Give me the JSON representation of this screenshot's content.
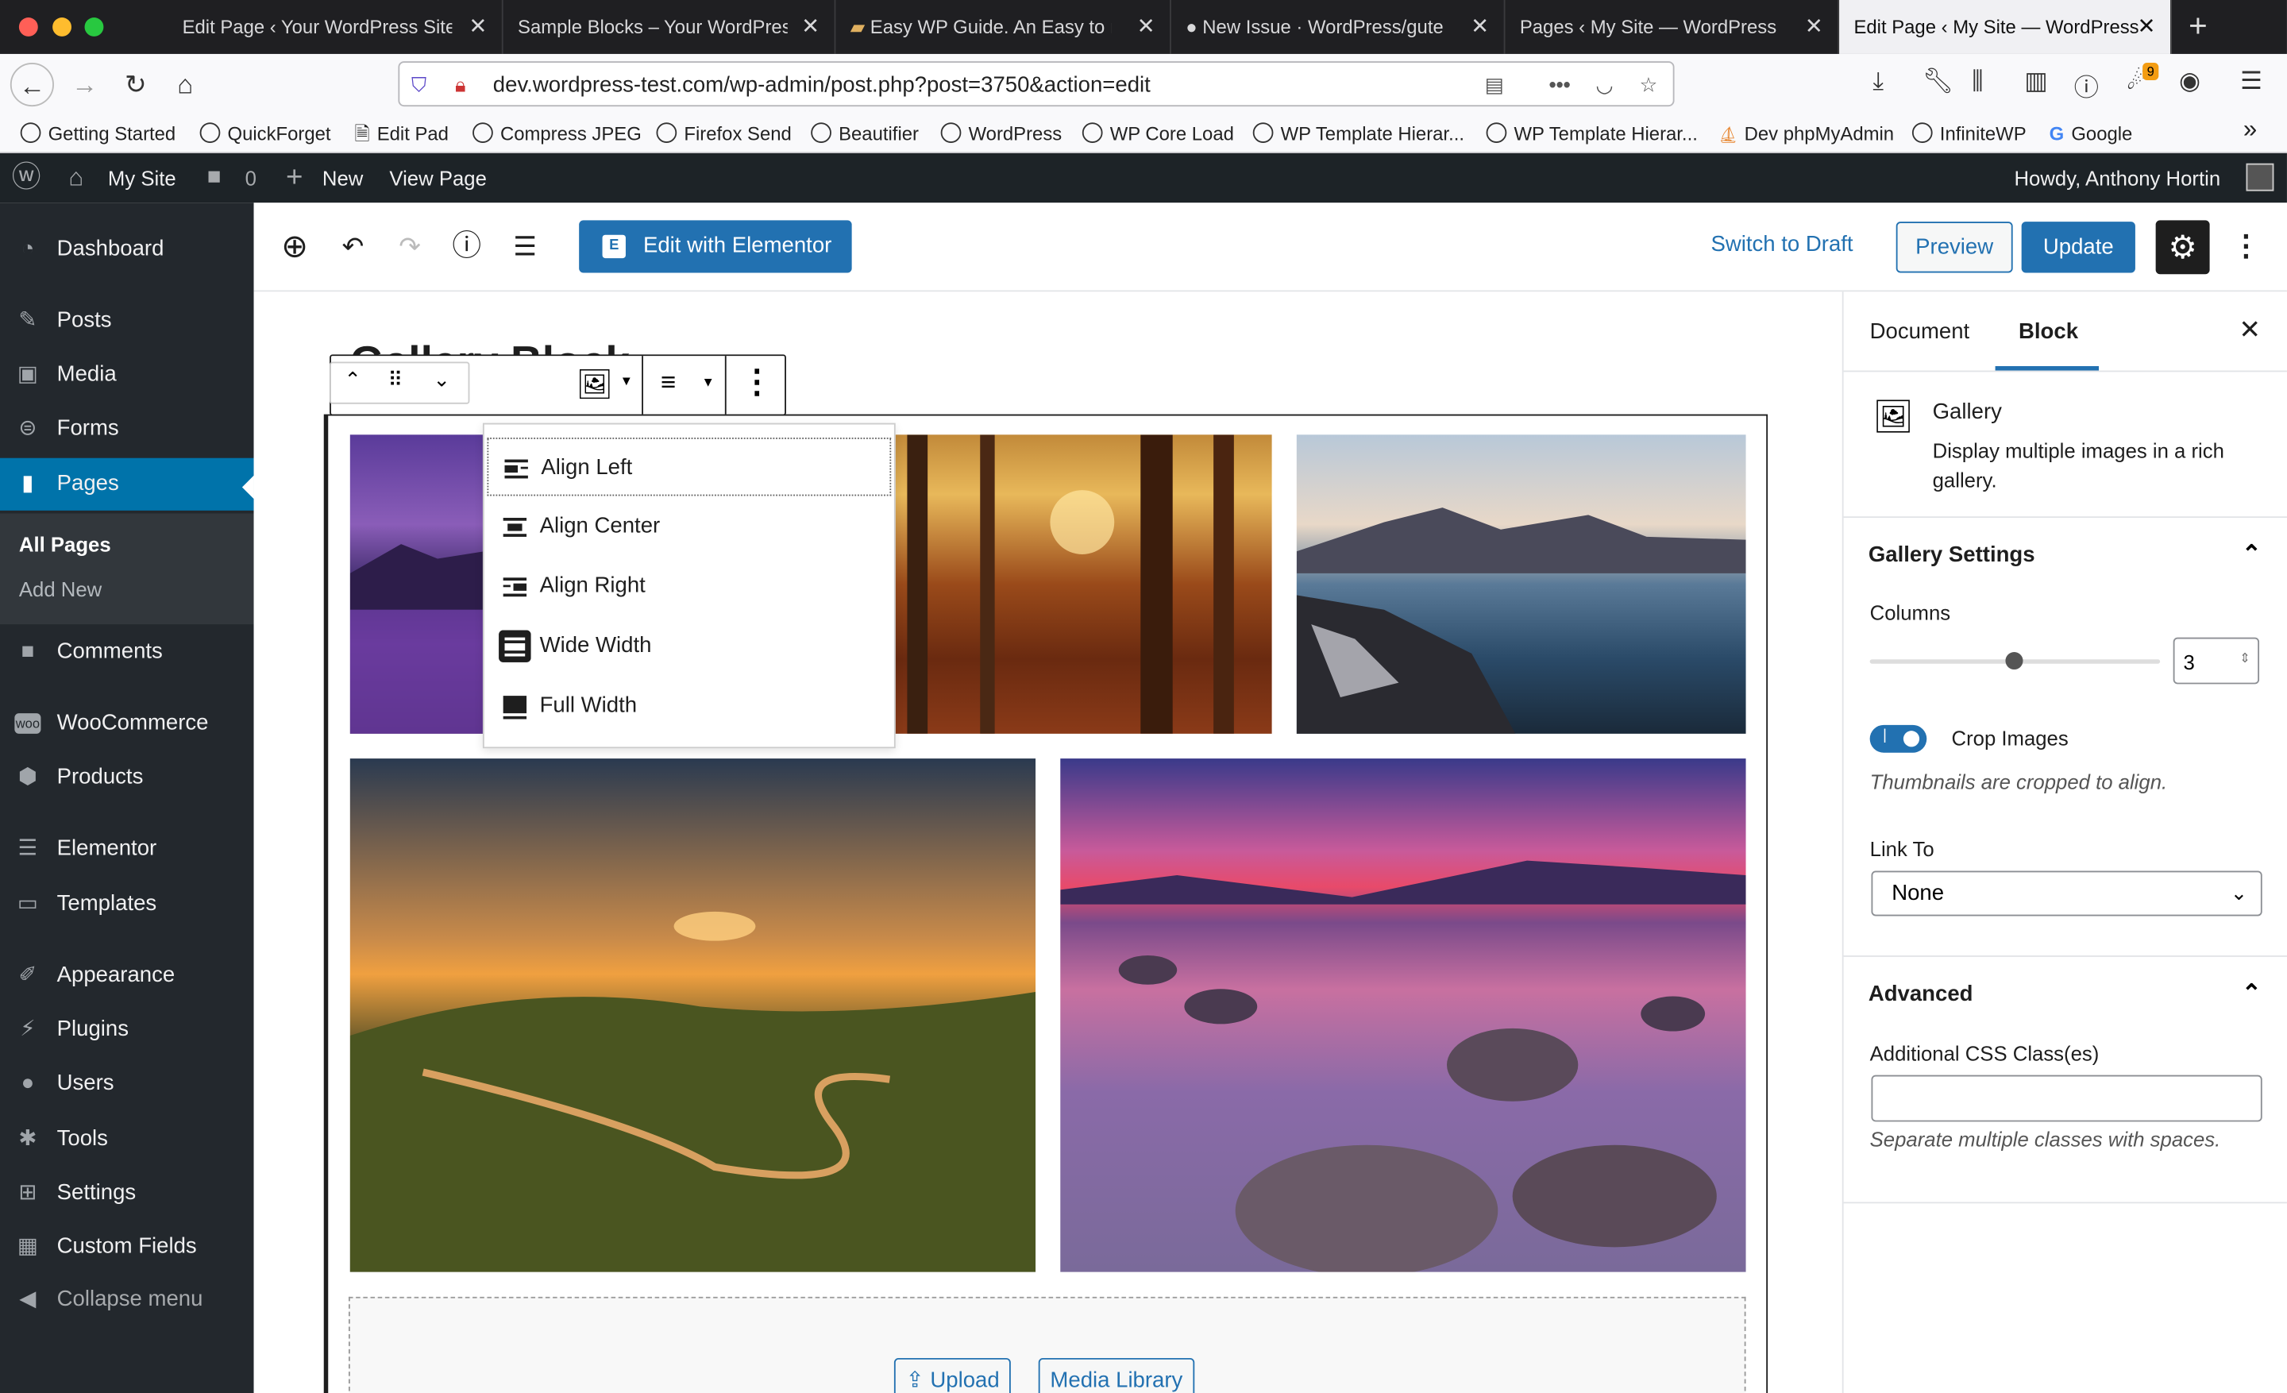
{
  "browser": {
    "tabs": [
      {
        "label": "Edit Page ‹ Your WordPress Site",
        "active": false
      },
      {
        "label": "Sample Blocks – Your WordPress",
        "active": false
      },
      {
        "label": "Easy WP Guide. An Easy to r",
        "active": false
      },
      {
        "label": "New Issue · WordPress/guter",
        "active": false
      },
      {
        "label": "Pages ‹ My Site — WordPress",
        "active": false
      },
      {
        "label": "Edit Page ‹ My Site — WordPress",
        "active": true
      }
    ],
    "url": "dev.wordpress-test.com/wp-admin/post.php?post=3750&action=edit",
    "extension_badge": "9",
    "bookmarks": [
      "Getting Started",
      "QuickForget",
      "Edit Pad",
      "Compress JPEG",
      "Firefox Send",
      "Beautifier",
      "WordPress",
      "WP Core Load",
      "WP Template Hierar...",
      "WP Template Hierar...",
      "Dev phpMyAdmin",
      "InfiniteWP",
      "Google"
    ]
  },
  "adminbar": {
    "site_name": "My Site",
    "comments_count": "0",
    "new_label": "New",
    "view_label": "View Page",
    "howdy": "Howdy, Anthony Hortin"
  },
  "sidebar": {
    "items": [
      {
        "label": "Dashboard",
        "icon": "dashboard-icon"
      },
      {
        "label": "Posts",
        "icon": "pin-icon"
      },
      {
        "label": "Media",
        "icon": "media-icon"
      },
      {
        "label": "Forms",
        "icon": "forms-icon"
      },
      {
        "label": "Pages",
        "icon": "pages-icon"
      },
      {
        "label": "Comments",
        "icon": "comment-icon"
      },
      {
        "label": "WooCommerce",
        "icon": "woo-icon"
      },
      {
        "label": "Products",
        "icon": "box-icon"
      },
      {
        "label": "Elementor",
        "icon": "elementor-icon"
      },
      {
        "label": "Templates",
        "icon": "folder-icon"
      },
      {
        "label": "Appearance",
        "icon": "brush-icon"
      },
      {
        "label": "Plugins",
        "icon": "plug-icon"
      },
      {
        "label": "Users",
        "icon": "user-icon"
      },
      {
        "label": "Tools",
        "icon": "wrench-icon"
      },
      {
        "label": "Settings",
        "icon": "sliders-icon"
      },
      {
        "label": "Custom Fields",
        "icon": "table-icon"
      },
      {
        "label": "Collapse menu",
        "icon": "collapse-icon"
      }
    ],
    "submenu": [
      "All Pages",
      "Add New"
    ]
  },
  "editor": {
    "elementor_label": "Edit with Elementor",
    "switch_draft": "Switch to Draft",
    "preview": "Preview",
    "update": "Update",
    "page_title": "Gallery Block",
    "upload": "Upload",
    "media_library": "Media Library"
  },
  "align_menu": [
    "Align Left",
    "Align Center",
    "Align Right",
    "Wide Width",
    "Full Width"
  ],
  "panel": {
    "tabs": [
      "Document",
      "Block"
    ],
    "block_name": "Gallery",
    "block_desc": "Display multiple images in a rich gallery.",
    "gallery_settings": "Gallery Settings",
    "columns_label": "Columns",
    "columns_value": "3",
    "columns_slider_fraction": 0.5,
    "crop_label": "Crop Images",
    "crop_on": true,
    "crop_help": "Thumbnails are cropped to align.",
    "link_to_label": "Link To",
    "link_to_value": "None",
    "advanced": "Advanced",
    "css_label": "Additional CSS Class(es)",
    "css_help": "Separate multiple classes with spaces."
  },
  "colors": {
    "wp_blue": "#2271b1",
    "admin_dark": "#23282d",
    "adminbar": "#1d2327"
  }
}
